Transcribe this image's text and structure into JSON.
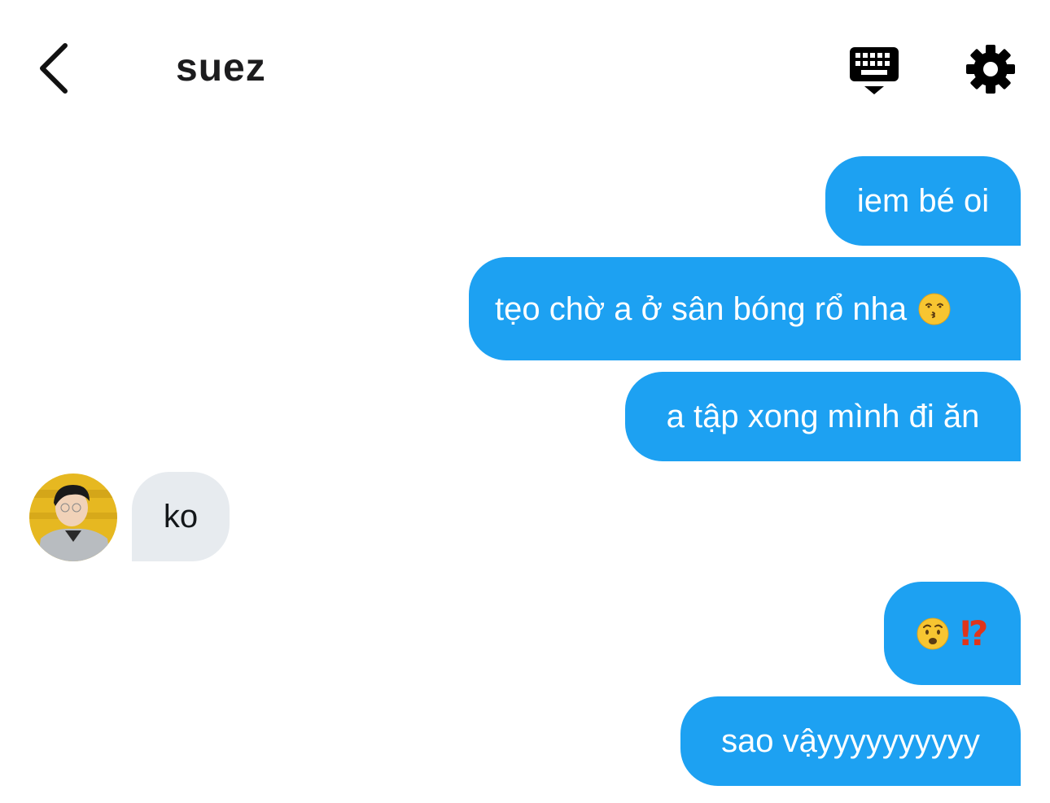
{
  "header": {
    "title": "suez",
    "back_icon": "chevron-left-icon",
    "keyboard_icon": "keyboard-hide-icon",
    "settings_icon": "gear-icon"
  },
  "messages": [
    {
      "direction": "out",
      "text": "iem bé oi"
    },
    {
      "direction": "out",
      "text": "tẹo chờ a ở sân bóng rổ nha",
      "emoji": "kissing-face-emoji"
    },
    {
      "direction": "out",
      "text": "a tập xong mình đi ăn"
    },
    {
      "direction": "in",
      "text": "ko"
    },
    {
      "direction": "out",
      "emoji": "anguished-face-emoji",
      "symbol": "⁉"
    },
    {
      "direction": "out",
      "text": "sao vậyyyyyyyyyy"
    }
  ],
  "colors": {
    "outgoing_bubble": "#1da1f2",
    "incoming_bubble": "#e7ebef",
    "outgoing_text": "#ffffff",
    "incoming_text": "#14171a",
    "interrobang": "#e0341b"
  }
}
